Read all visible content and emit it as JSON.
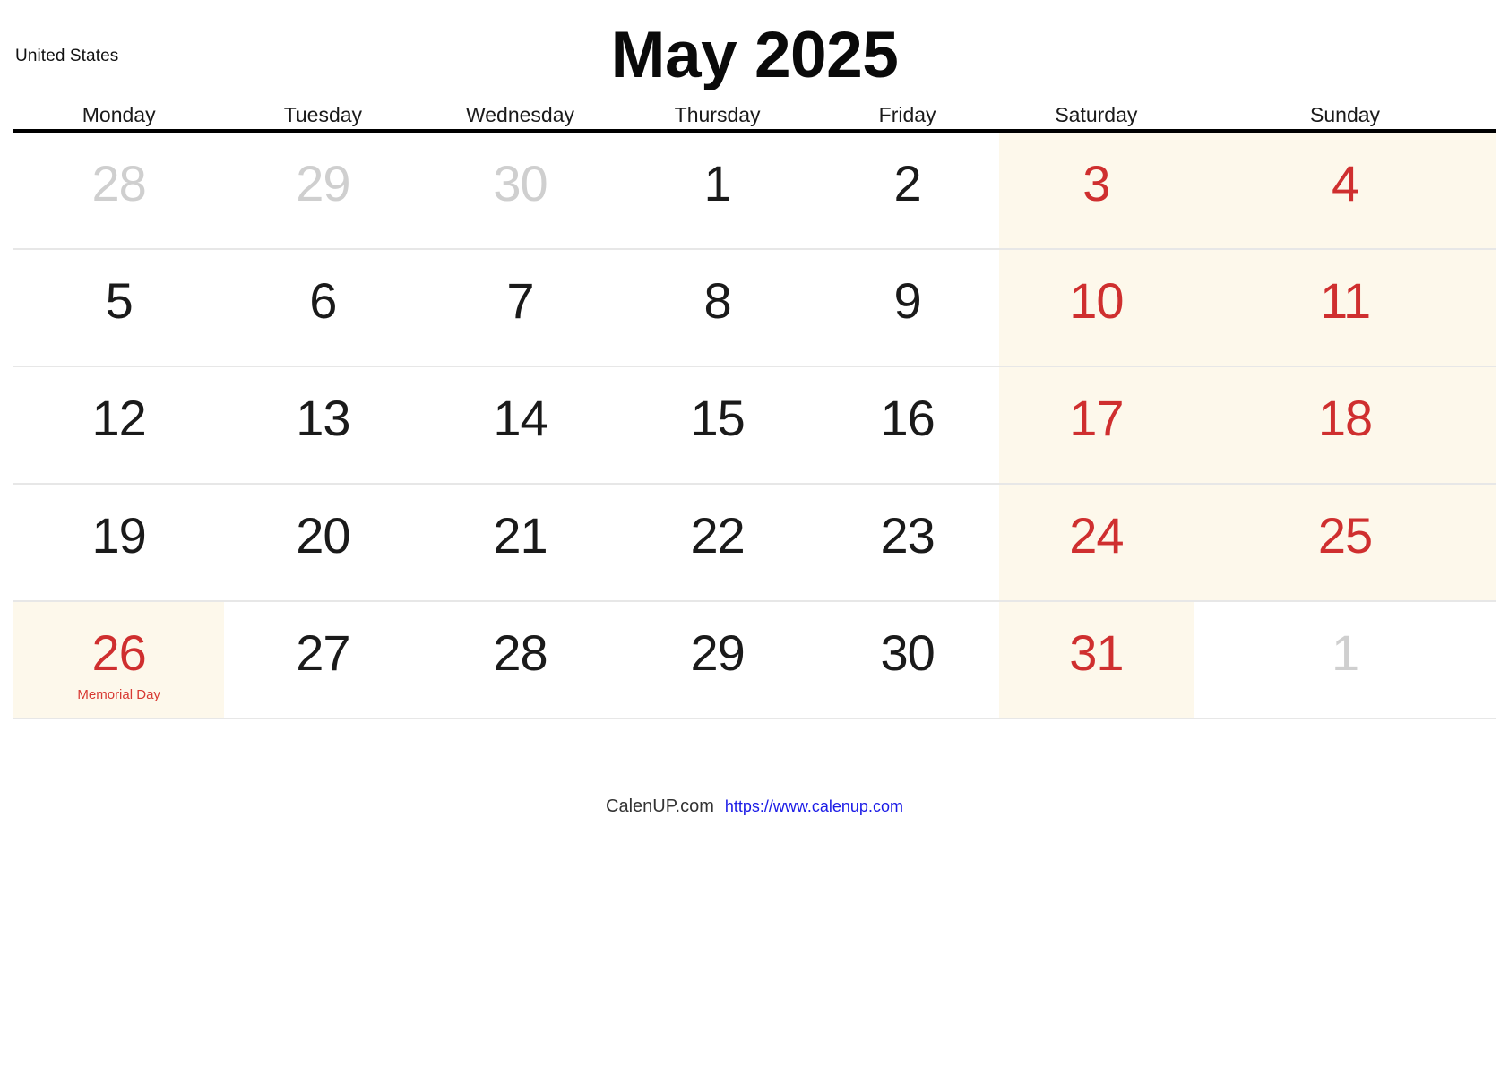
{
  "header": {
    "country": "United States",
    "title": "May 2025"
  },
  "weekdays": [
    "Monday",
    "Tuesday",
    "Wednesday",
    "Thursday",
    "Friday",
    "Saturday",
    "Sunday"
  ],
  "colors": {
    "weekend_background": "#fdf8eb",
    "weekend_text": "#cf2f2f",
    "holiday_text": "#d83a33",
    "outside_month_text": "#cfcfcf",
    "day_text": "#1a1a1a",
    "header_rule": "#000000",
    "row_divider": "#e7e7e7",
    "url_link": "#1a1ae6"
  },
  "weeks": [
    {
      "days": [
        {
          "num": "28",
          "outside": true,
          "weekend": false,
          "holiday": ""
        },
        {
          "num": "29",
          "outside": true,
          "weekend": false,
          "holiday": ""
        },
        {
          "num": "30",
          "outside": true,
          "weekend": false,
          "holiday": ""
        },
        {
          "num": "1",
          "outside": false,
          "weekend": false,
          "holiday": ""
        },
        {
          "num": "2",
          "outside": false,
          "weekend": false,
          "holiday": ""
        },
        {
          "num": "3",
          "outside": false,
          "weekend": true,
          "holiday": ""
        },
        {
          "num": "4",
          "outside": false,
          "weekend": true,
          "holiday": ""
        }
      ]
    },
    {
      "days": [
        {
          "num": "5",
          "outside": false,
          "weekend": false,
          "holiday": ""
        },
        {
          "num": "6",
          "outside": false,
          "weekend": false,
          "holiday": ""
        },
        {
          "num": "7",
          "outside": false,
          "weekend": false,
          "holiday": ""
        },
        {
          "num": "8",
          "outside": false,
          "weekend": false,
          "holiday": ""
        },
        {
          "num": "9",
          "outside": false,
          "weekend": false,
          "holiday": ""
        },
        {
          "num": "10",
          "outside": false,
          "weekend": true,
          "holiday": ""
        },
        {
          "num": "11",
          "outside": false,
          "weekend": true,
          "holiday": ""
        }
      ]
    },
    {
      "days": [
        {
          "num": "12",
          "outside": false,
          "weekend": false,
          "holiday": ""
        },
        {
          "num": "13",
          "outside": false,
          "weekend": false,
          "holiday": ""
        },
        {
          "num": "14",
          "outside": false,
          "weekend": false,
          "holiday": ""
        },
        {
          "num": "15",
          "outside": false,
          "weekend": false,
          "holiday": ""
        },
        {
          "num": "16",
          "outside": false,
          "weekend": false,
          "holiday": ""
        },
        {
          "num": "17",
          "outside": false,
          "weekend": true,
          "holiday": ""
        },
        {
          "num": "18",
          "outside": false,
          "weekend": true,
          "holiday": ""
        }
      ]
    },
    {
      "days": [
        {
          "num": "19",
          "outside": false,
          "weekend": false,
          "holiday": ""
        },
        {
          "num": "20",
          "outside": false,
          "weekend": false,
          "holiday": ""
        },
        {
          "num": "21",
          "outside": false,
          "weekend": false,
          "holiday": ""
        },
        {
          "num": "22",
          "outside": false,
          "weekend": false,
          "holiday": ""
        },
        {
          "num": "23",
          "outside": false,
          "weekend": false,
          "holiday": ""
        },
        {
          "num": "24",
          "outside": false,
          "weekend": true,
          "holiday": ""
        },
        {
          "num": "25",
          "outside": false,
          "weekend": true,
          "holiday": ""
        }
      ]
    },
    {
      "days": [
        {
          "num": "26",
          "outside": false,
          "weekend": false,
          "holiday": "Memorial Day"
        },
        {
          "num": "27",
          "outside": false,
          "weekend": false,
          "holiday": ""
        },
        {
          "num": "28",
          "outside": false,
          "weekend": false,
          "holiday": ""
        },
        {
          "num": "29",
          "outside": false,
          "weekend": false,
          "holiday": ""
        },
        {
          "num": "30",
          "outside": false,
          "weekend": false,
          "holiday": ""
        },
        {
          "num": "31",
          "outside": false,
          "weekend": true,
          "holiday": ""
        },
        {
          "num": "1",
          "outside": true,
          "weekend": false,
          "holiday": ""
        }
      ]
    }
  ],
  "footer": {
    "brand": "CalenUP.com",
    "url": "https://www.calenup.com"
  }
}
